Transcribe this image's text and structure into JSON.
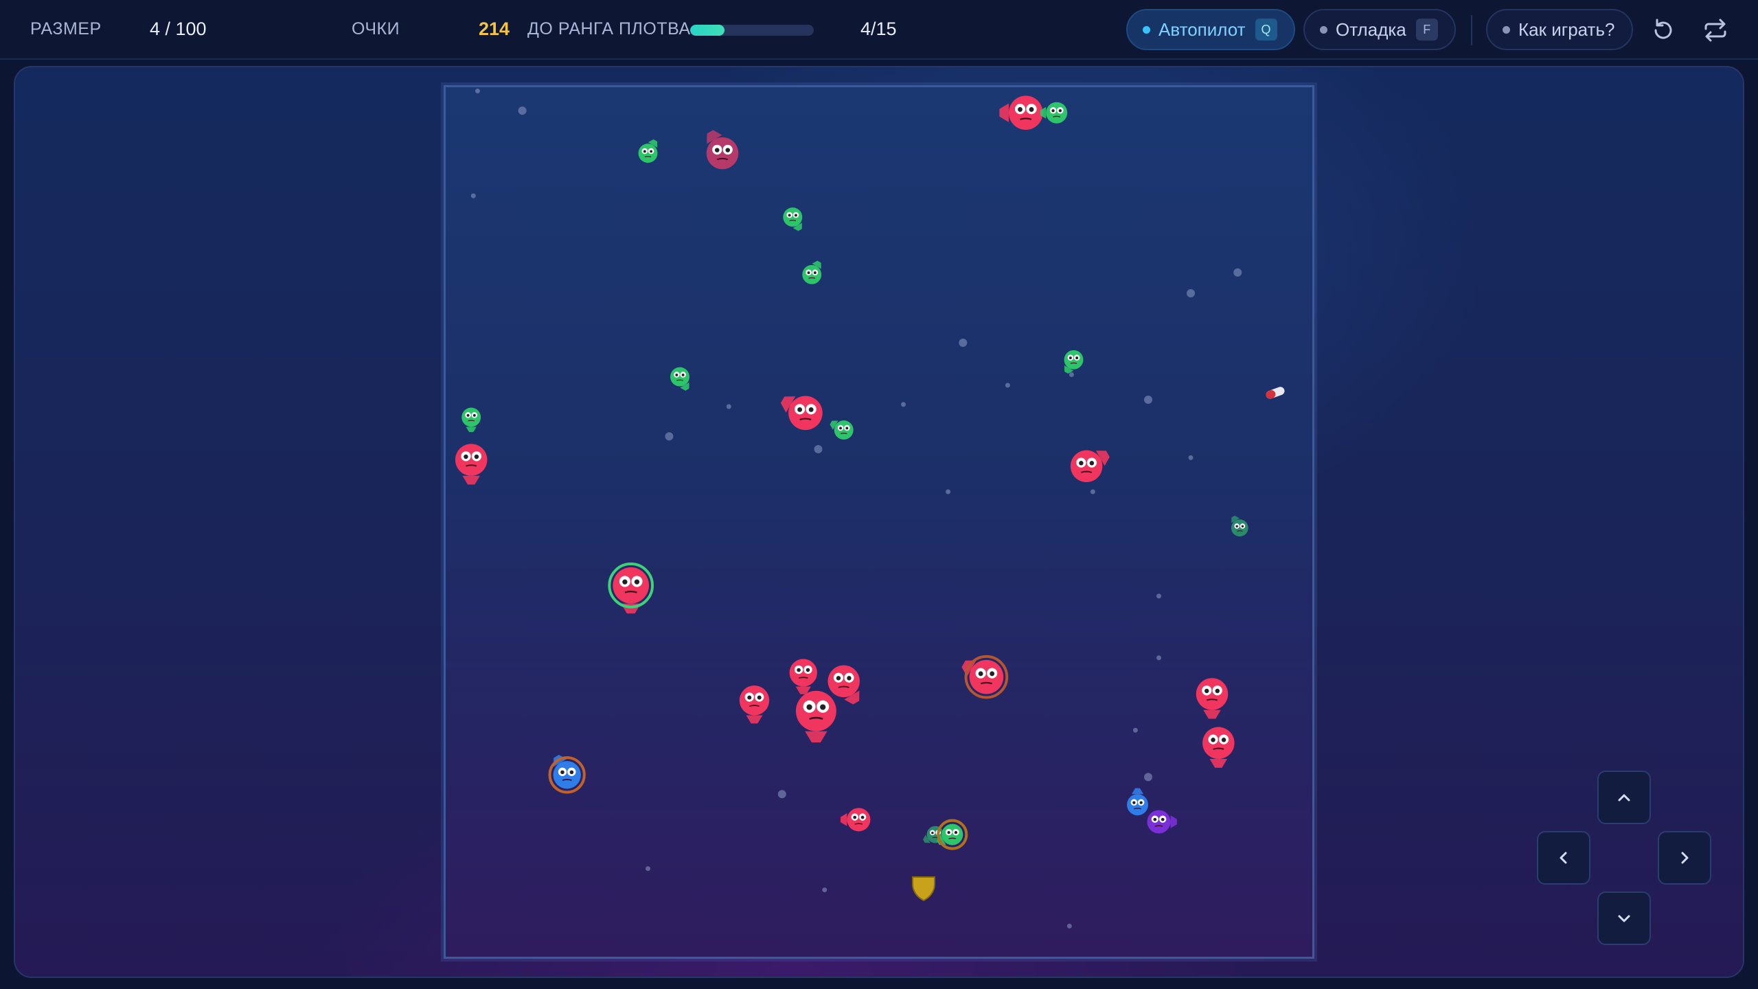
{
  "hud": {
    "size_label": "РАЗМЕР",
    "size_value": "4 / 100",
    "score_label": "ОЧКИ",
    "score_value": "214",
    "rank_label": "ДО РАНГА ПЛОТВА",
    "rank_progress": 0.28,
    "rank_value": "4/15"
  },
  "buttons": {
    "autopilot": {
      "label": "Автопилот",
      "key": "Q"
    },
    "debug": {
      "label": "Отладка",
      "key": "F"
    },
    "help": {
      "label": "Как играть?"
    }
  },
  "icons": {
    "restart": "restart-icon",
    "swap": "swap-icon",
    "up": "chevron-up-icon",
    "left": "chevron-left-icon",
    "right": "chevron-right-icon",
    "down": "chevron-down-icon"
  },
  "colors": {
    "score": "#f4c542",
    "accent": "#38c3ff",
    "fish_red": "#f0365e",
    "fish_green": "#2ec46a",
    "fish_blue": "#2f7de8",
    "fish_purple": "#7a2fd8"
  }
}
